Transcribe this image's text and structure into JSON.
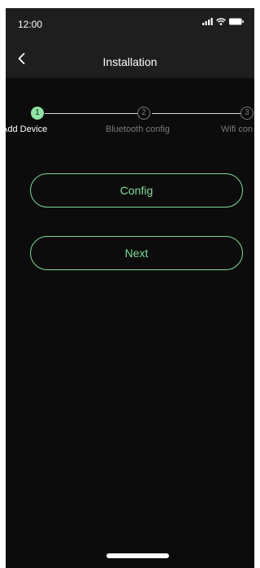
{
  "status_bar": {
    "time": "12:00",
    "icons": [
      "signal-icon",
      "wifi-icon",
      "battery-icon"
    ]
  },
  "nav": {
    "title": "Installation",
    "back_icon": "chevron-left-icon"
  },
  "steps": [
    {
      "number": "1",
      "label": "Add Device",
      "state": "active"
    },
    {
      "number": "2",
      "label": "Bluetooth config",
      "state": "inactive"
    },
    {
      "number": "3",
      "label": "Wifi con",
      "state": "inactive"
    }
  ],
  "buttons": {
    "config_label": "Config",
    "next_label": "Next"
  },
  "colors": {
    "accent": "#7edc96",
    "active_step": "#8fe3a6",
    "inactive_step": "#7a7a7a",
    "background": "#0c0c0c",
    "bar": "#1e1e1e"
  }
}
